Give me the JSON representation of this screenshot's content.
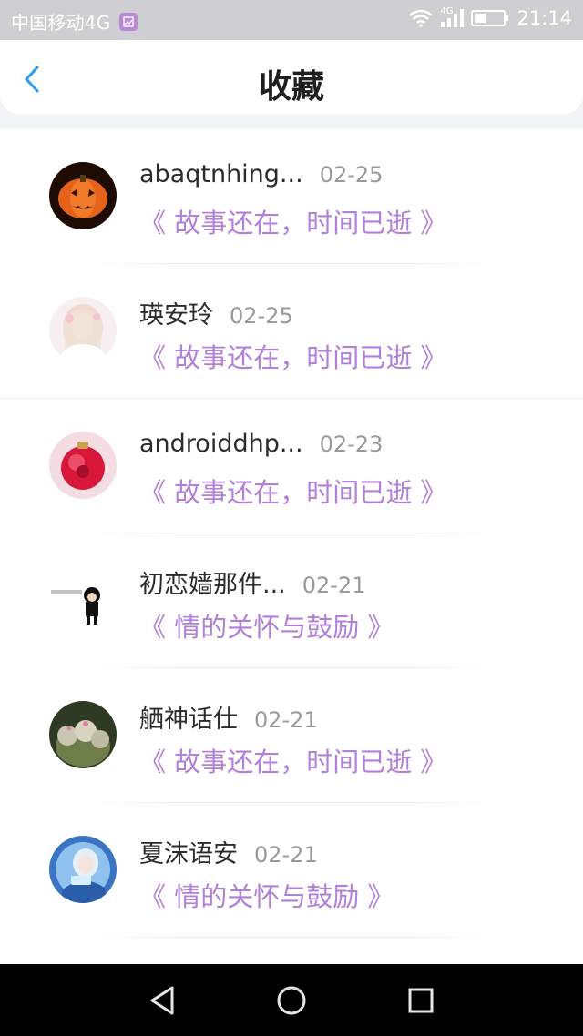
{
  "status_bar": {
    "carrier": "中国移动4G",
    "network": "4G",
    "time": "21:14"
  },
  "header": {
    "title": "收藏",
    "back_icon": "chevron-left-icon"
  },
  "colors": {
    "accent_purple": "#b27fd9",
    "back_blue": "#2f9af0",
    "date_gray": "#9a9a9a",
    "name_dark": "#2b2b2b"
  },
  "favorites": [
    {
      "name": "abaqtnhing...",
      "date": "02-25",
      "title": "《 故事还在，时间已逝 》",
      "avatar": "pumpkin-avatar"
    },
    {
      "name": "瑛安玲",
      "date": "02-25",
      "title": "《 故事还在，时间已逝 》",
      "avatar": "anime-girl-avatar"
    },
    {
      "name": "androiddhp...",
      "date": "02-23",
      "title": "《 故事还在，时间已逝 》",
      "avatar": "red-ornament-avatar"
    },
    {
      "name": "初恋嫱那件...",
      "date": "02-21",
      "title": "《 情的关怀与鼓励 》",
      "avatar": "chibi-figure-avatar"
    },
    {
      "name": "舾神话仕",
      "date": "02-21",
      "title": "《 故事还在，时间已逝 》",
      "avatar": "cactus-avatar"
    },
    {
      "name": "夏沫语安",
      "date": "02-21",
      "title": "《 情的关怀与鼓励 》",
      "avatar": "blue-anime-avatar"
    }
  ],
  "nav_bar": {
    "back_icon": "triangle-back-icon",
    "home_icon": "circle-home-icon",
    "recents_icon": "square-recents-icon"
  }
}
